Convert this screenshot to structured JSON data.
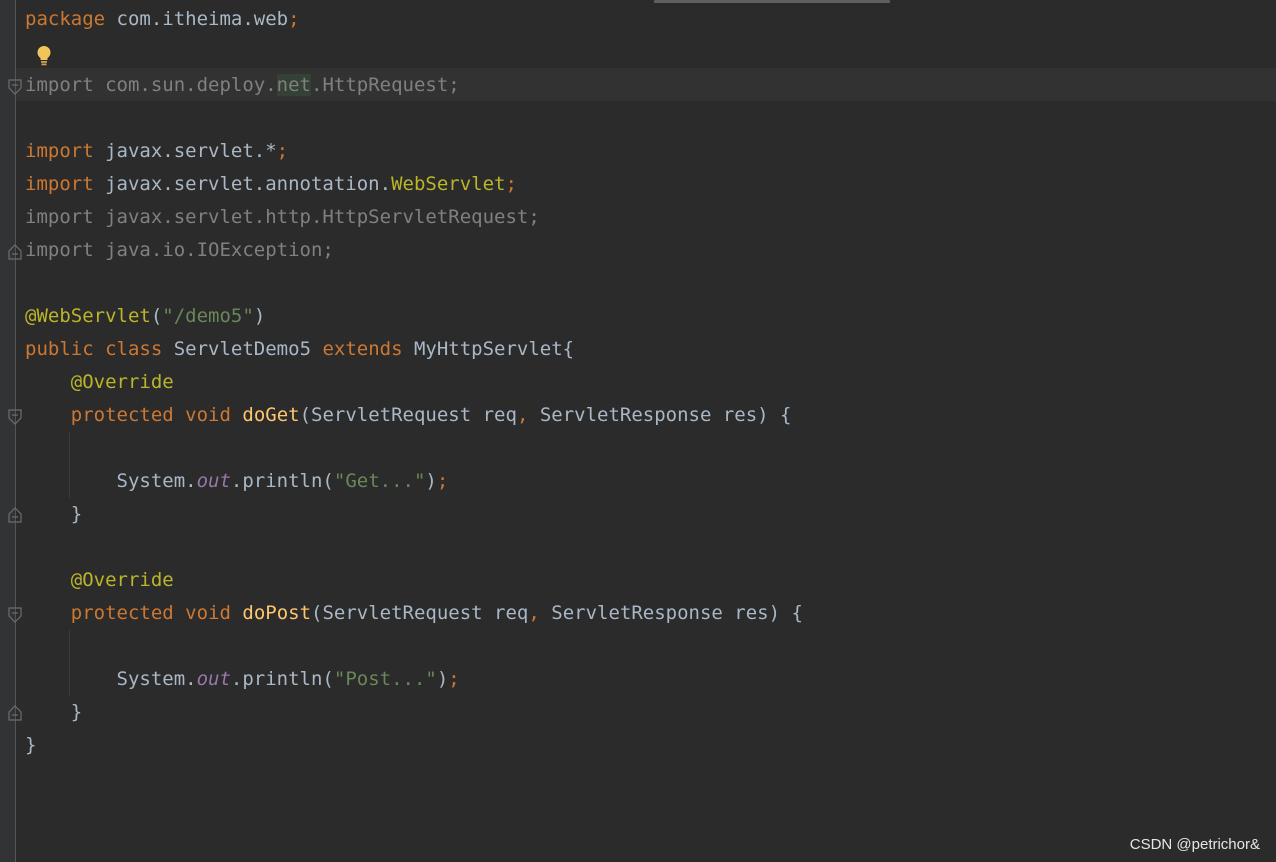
{
  "editor": {
    "lines": [
      {
        "tokens": [
          {
            "t": "package",
            "c": "k"
          },
          {
            "t": " com.itheima.web",
            "c": ""
          },
          {
            "t": ";",
            "c": "p"
          }
        ]
      },
      {
        "tokens": []
      },
      {
        "tokens": [
          {
            "t": "import",
            "c": "dimk"
          },
          {
            "t": " com.sun.deploy.",
            "c": "dim"
          },
          {
            "t": "net",
            "c": "hl-net"
          },
          {
            "t": ".HttpRequest;",
            "c": "dim"
          }
        ]
      },
      {
        "tokens": []
      },
      {
        "tokens": [
          {
            "t": "import",
            "c": "k"
          },
          {
            "t": " javax.servlet.*",
            "c": ""
          },
          {
            "t": ";",
            "c": "p"
          }
        ]
      },
      {
        "tokens": [
          {
            "t": "import",
            "c": "k"
          },
          {
            "t": " javax.servlet.annotation.",
            "c": ""
          },
          {
            "t": "WebServlet",
            "c": "ann"
          },
          {
            "t": ";",
            "c": "p"
          }
        ]
      },
      {
        "tokens": [
          {
            "t": "import",
            "c": "dimk"
          },
          {
            "t": " javax.servlet.http.HttpServletRequest;",
            "c": "dim"
          }
        ]
      },
      {
        "tokens": [
          {
            "t": "import",
            "c": "dimk"
          },
          {
            "t": " java.io.IOException;",
            "c": "dim"
          }
        ]
      },
      {
        "tokens": []
      },
      {
        "tokens": [
          {
            "t": "@WebServlet",
            "c": "ann"
          },
          {
            "t": "(",
            "c": ""
          },
          {
            "t": "\"/demo5\"",
            "c": "s"
          },
          {
            "t": ")",
            "c": ""
          }
        ]
      },
      {
        "tokens": [
          {
            "t": "public",
            "c": "k"
          },
          {
            "t": " ",
            "c": ""
          },
          {
            "t": "class",
            "c": "k"
          },
          {
            "t": " ServletDemo5 ",
            "c": ""
          },
          {
            "t": "extends",
            "c": "k"
          },
          {
            "t": " MyHttpServlet{",
            "c": ""
          }
        ]
      },
      {
        "tokens": [
          {
            "t": "    ",
            "c": ""
          },
          {
            "t": "@Override",
            "c": "ann"
          }
        ]
      },
      {
        "tokens": [
          {
            "t": "    ",
            "c": ""
          },
          {
            "t": "protected",
            "c": "k"
          },
          {
            "t": " ",
            "c": ""
          },
          {
            "t": "void",
            "c": "k"
          },
          {
            "t": " ",
            "c": ""
          },
          {
            "t": "doGet",
            "c": "fn"
          },
          {
            "t": "(ServletRequest req",
            "c": ""
          },
          {
            "t": ",",
            "c": "p"
          },
          {
            "t": " ServletResponse res) {",
            "c": ""
          }
        ]
      },
      {
        "tokens": []
      },
      {
        "tokens": [
          {
            "t": "        System.",
            "c": ""
          },
          {
            "t": "out",
            "c": "st"
          },
          {
            "t": ".println(",
            "c": ""
          },
          {
            "t": "\"Get...\"",
            "c": "s"
          },
          {
            "t": ")",
            "c": ""
          },
          {
            "t": ";",
            "c": "p"
          }
        ]
      },
      {
        "tokens": [
          {
            "t": "    }",
            "c": ""
          }
        ]
      },
      {
        "tokens": []
      },
      {
        "tokens": [
          {
            "t": "    ",
            "c": ""
          },
          {
            "t": "@Override",
            "c": "ann"
          }
        ]
      },
      {
        "tokens": [
          {
            "t": "    ",
            "c": ""
          },
          {
            "t": "protected",
            "c": "k"
          },
          {
            "t": " ",
            "c": ""
          },
          {
            "t": "void",
            "c": "k"
          },
          {
            "t": " ",
            "c": ""
          },
          {
            "t": "doPost",
            "c": "fn"
          },
          {
            "t": "(ServletRequest req",
            "c": ""
          },
          {
            "t": ",",
            "c": "p"
          },
          {
            "t": " ServletResponse res) {",
            "c": ""
          }
        ]
      },
      {
        "tokens": []
      },
      {
        "tokens": [
          {
            "t": "        System.",
            "c": ""
          },
          {
            "t": "out",
            "c": "st"
          },
          {
            "t": ".println(",
            "c": ""
          },
          {
            "t": "\"Post...\"",
            "c": "s"
          },
          {
            "t": ")",
            "c": ""
          },
          {
            "t": ";",
            "c": "p"
          }
        ]
      },
      {
        "tokens": [
          {
            "t": "    }",
            "c": ""
          }
        ]
      },
      {
        "tokens": [
          {
            "t": "}",
            "c": ""
          }
        ]
      }
    ]
  },
  "watermark": "CSDN @petrichor&",
  "colors": {
    "background": "#2b2b2b",
    "keyword": "#cc7832",
    "annotation": "#bbb529",
    "string": "#6a8759",
    "method": "#ffc66d",
    "static_field": "#9876aa",
    "text": "#a9b7c6",
    "unused_import": "#808080"
  },
  "icons": [
    "intention-bulb-icon",
    "fold-marker-icon"
  ]
}
